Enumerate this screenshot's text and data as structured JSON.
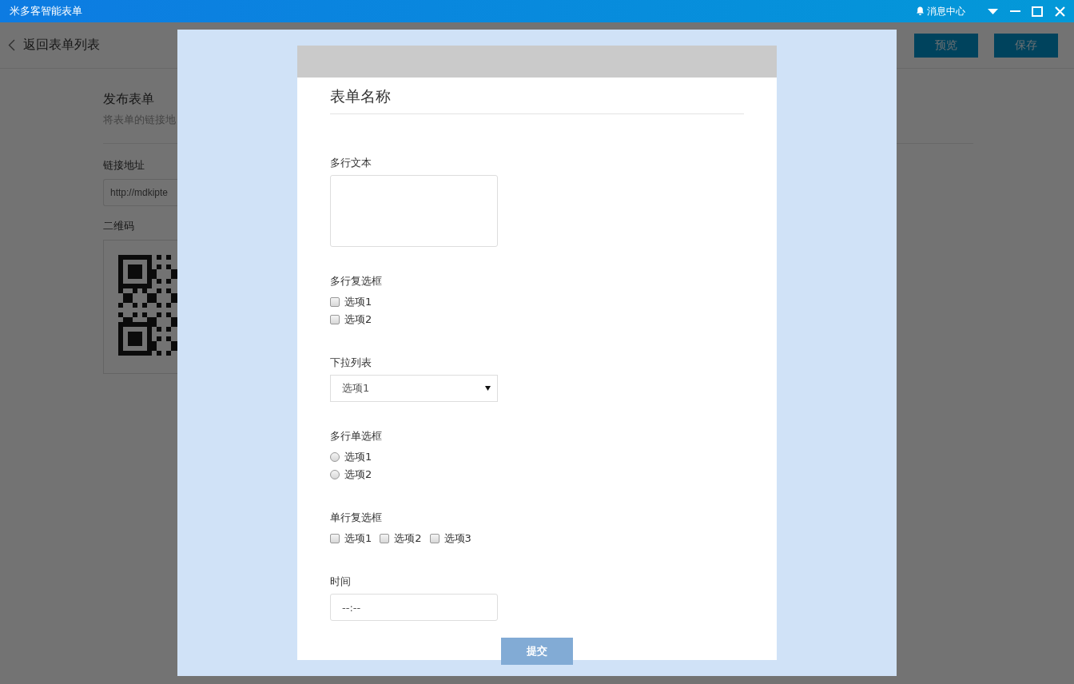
{
  "window": {
    "title": "米多客智能表单",
    "notifications": "消息中心"
  },
  "header": {
    "back": "返回表单列表",
    "buttons": [
      "预览",
      "保存"
    ]
  },
  "publish": {
    "title": "发布表单",
    "description": "将表单的链接地",
    "link_label": "链接地址",
    "link_value": "http://mdkipte",
    "qr_label": "二维码"
  },
  "form": {
    "title": "表单名称",
    "fields": [
      {
        "kind": "textarea",
        "label": "多行文本"
      },
      {
        "kind": "checkbox-column",
        "label": "多行复选框",
        "options": [
          {
            "label": "选项1",
            "checked": false
          },
          {
            "label": "选项2",
            "checked": false
          }
        ]
      },
      {
        "kind": "select",
        "label": "下拉列表",
        "value": "选项1"
      },
      {
        "kind": "radio-column",
        "label": "多行单选框",
        "options": [
          {
            "label": "选项1",
            "selected": false
          },
          {
            "label": "选项2",
            "selected": false
          }
        ]
      },
      {
        "kind": "checkbox-row",
        "label": "单行复选框",
        "options": [
          {
            "label": "选项1",
            "checked": false
          },
          {
            "label": "选项2",
            "checked": false
          },
          {
            "label": "选项3",
            "checked": false
          }
        ]
      },
      {
        "kind": "time",
        "label": "时间",
        "placeholder": "--:--"
      }
    ],
    "submit": "提交"
  }
}
